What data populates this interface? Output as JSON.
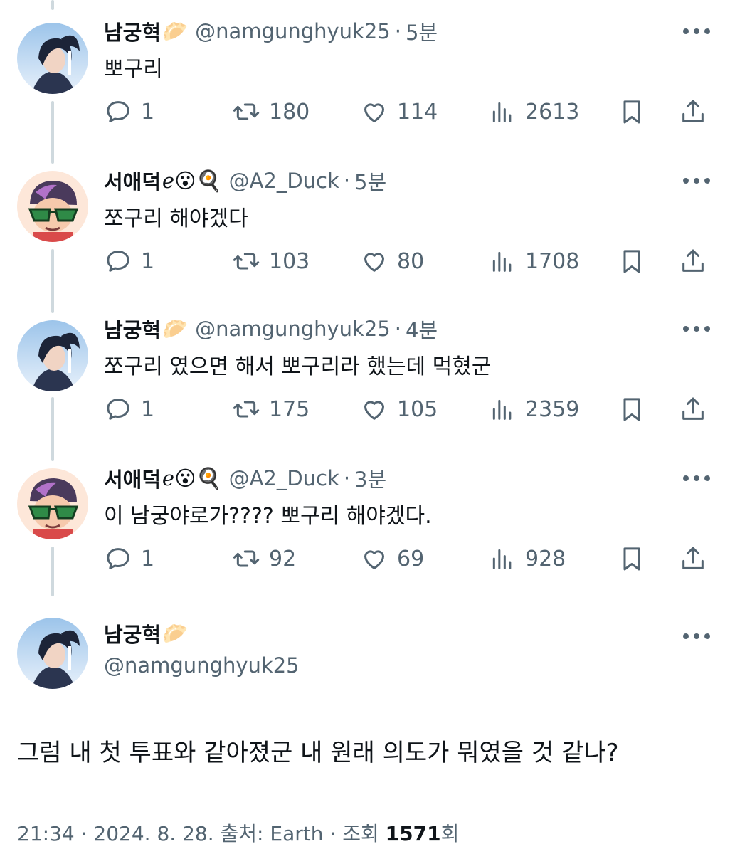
{
  "thread": [
    {
      "avatar": "avatar-namgunghyuk",
      "name": "남궁혁",
      "emoji": "🥟",
      "handle": "@namgunghyuk25",
      "dot": "·",
      "time": "5분",
      "text": "뽀구리",
      "reply_count": "1",
      "retweet_count": "180",
      "like_count": "114",
      "view_count": "2613"
    },
    {
      "avatar": "avatar-a2duck",
      "name": "서애덕",
      "emoji": "ℯ😮🍳",
      "handle": "@A2_Duck",
      "dot": "·",
      "time": "5분",
      "text": "쪼구리 해야겠다",
      "reply_count": "1",
      "retweet_count": "103",
      "like_count": "80",
      "view_count": "1708"
    },
    {
      "avatar": "avatar-namgunghyuk",
      "name": "남궁혁",
      "emoji": "🥟",
      "handle": "@namgunghyuk25",
      "dot": "·",
      "time": "4분",
      "text": "쪼구리 였으면 해서 뽀구리라 했는데 먹혔군",
      "reply_count": "1",
      "retweet_count": "175",
      "like_count": "105",
      "view_count": "2359"
    },
    {
      "avatar": "avatar-a2duck",
      "name": "서애덕",
      "emoji": "ℯ😮🍳",
      "handle": "@A2_Duck",
      "dot": "·",
      "time": "3분",
      "text": "이 남궁야로가???? 뽀구리 해야겠다.",
      "reply_count": "1",
      "retweet_count": "92",
      "like_count": "69",
      "view_count": "928"
    }
  ],
  "main_tweet": {
    "name": "남궁혁",
    "emoji": "🥟",
    "handle": "@namgunghyuk25",
    "text": "그럼 내 첫 투표와 같아졌군 내 원래 의도가 뭐였을 것 같나?",
    "time": "21:34",
    "sep1": "·",
    "date": "2024. 8. 28.",
    "source_label": "출처: Earth",
    "sep2": "·",
    "views_label": "조회",
    "views_count": "1571",
    "views_suffix": "회"
  },
  "colors": {
    "text_primary": "#0f1419",
    "text_secondary": "#536471",
    "thread_line": "#cfd9de",
    "background": "#ffffff"
  },
  "icons": [
    "reply-icon",
    "retweet-icon",
    "like-icon",
    "views-icon",
    "bookmark-icon",
    "share-icon",
    "more-icon"
  ]
}
